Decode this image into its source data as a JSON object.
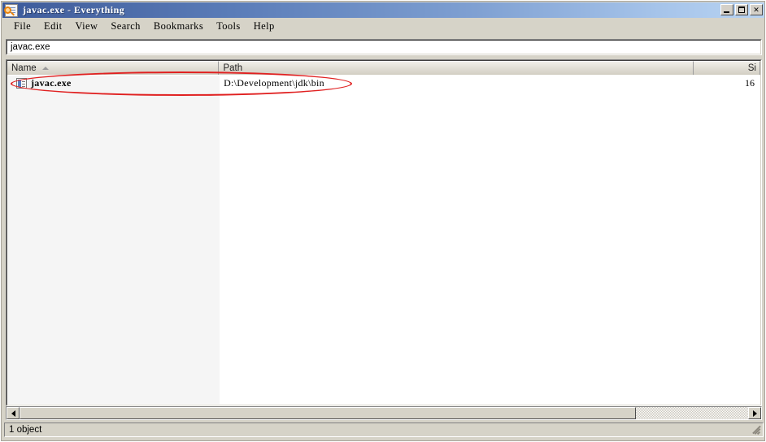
{
  "window": {
    "title": "javac.exe - Everything",
    "icon": "magnifier-document-icon",
    "controls": {
      "minimize": "_",
      "maximize": "□",
      "close": "✕"
    }
  },
  "menubar": {
    "items": [
      {
        "label": "File"
      },
      {
        "label": "Edit"
      },
      {
        "label": "View"
      },
      {
        "label": "Search"
      },
      {
        "label": "Bookmarks"
      },
      {
        "label": "Tools"
      },
      {
        "label": "Help"
      }
    ]
  },
  "search": {
    "value": "javac.exe",
    "placeholder": ""
  },
  "listview": {
    "columns": [
      {
        "label": "Name",
        "sort": "ascending"
      },
      {
        "label": "Path",
        "sort": "none"
      },
      {
        "label": "Si",
        "sort": "none"
      }
    ],
    "rows": [
      {
        "icon": "file-icon",
        "name": "javac.exe",
        "path": "D:\\Development\\jdk\\bin",
        "size": "16"
      }
    ]
  },
  "annotation": {
    "shape": "ellipse",
    "color": "#e02020"
  },
  "statusbar": {
    "text": "1 object"
  },
  "scrollbar": {
    "left_arrow": "◀",
    "right_arrow": "▶"
  },
  "colors": {
    "title_gradient_start": "#3a5a9c",
    "title_gradient_end": "#b9d4f2",
    "chrome": "#d6d3c8",
    "annotation_red": "#e02020"
  }
}
